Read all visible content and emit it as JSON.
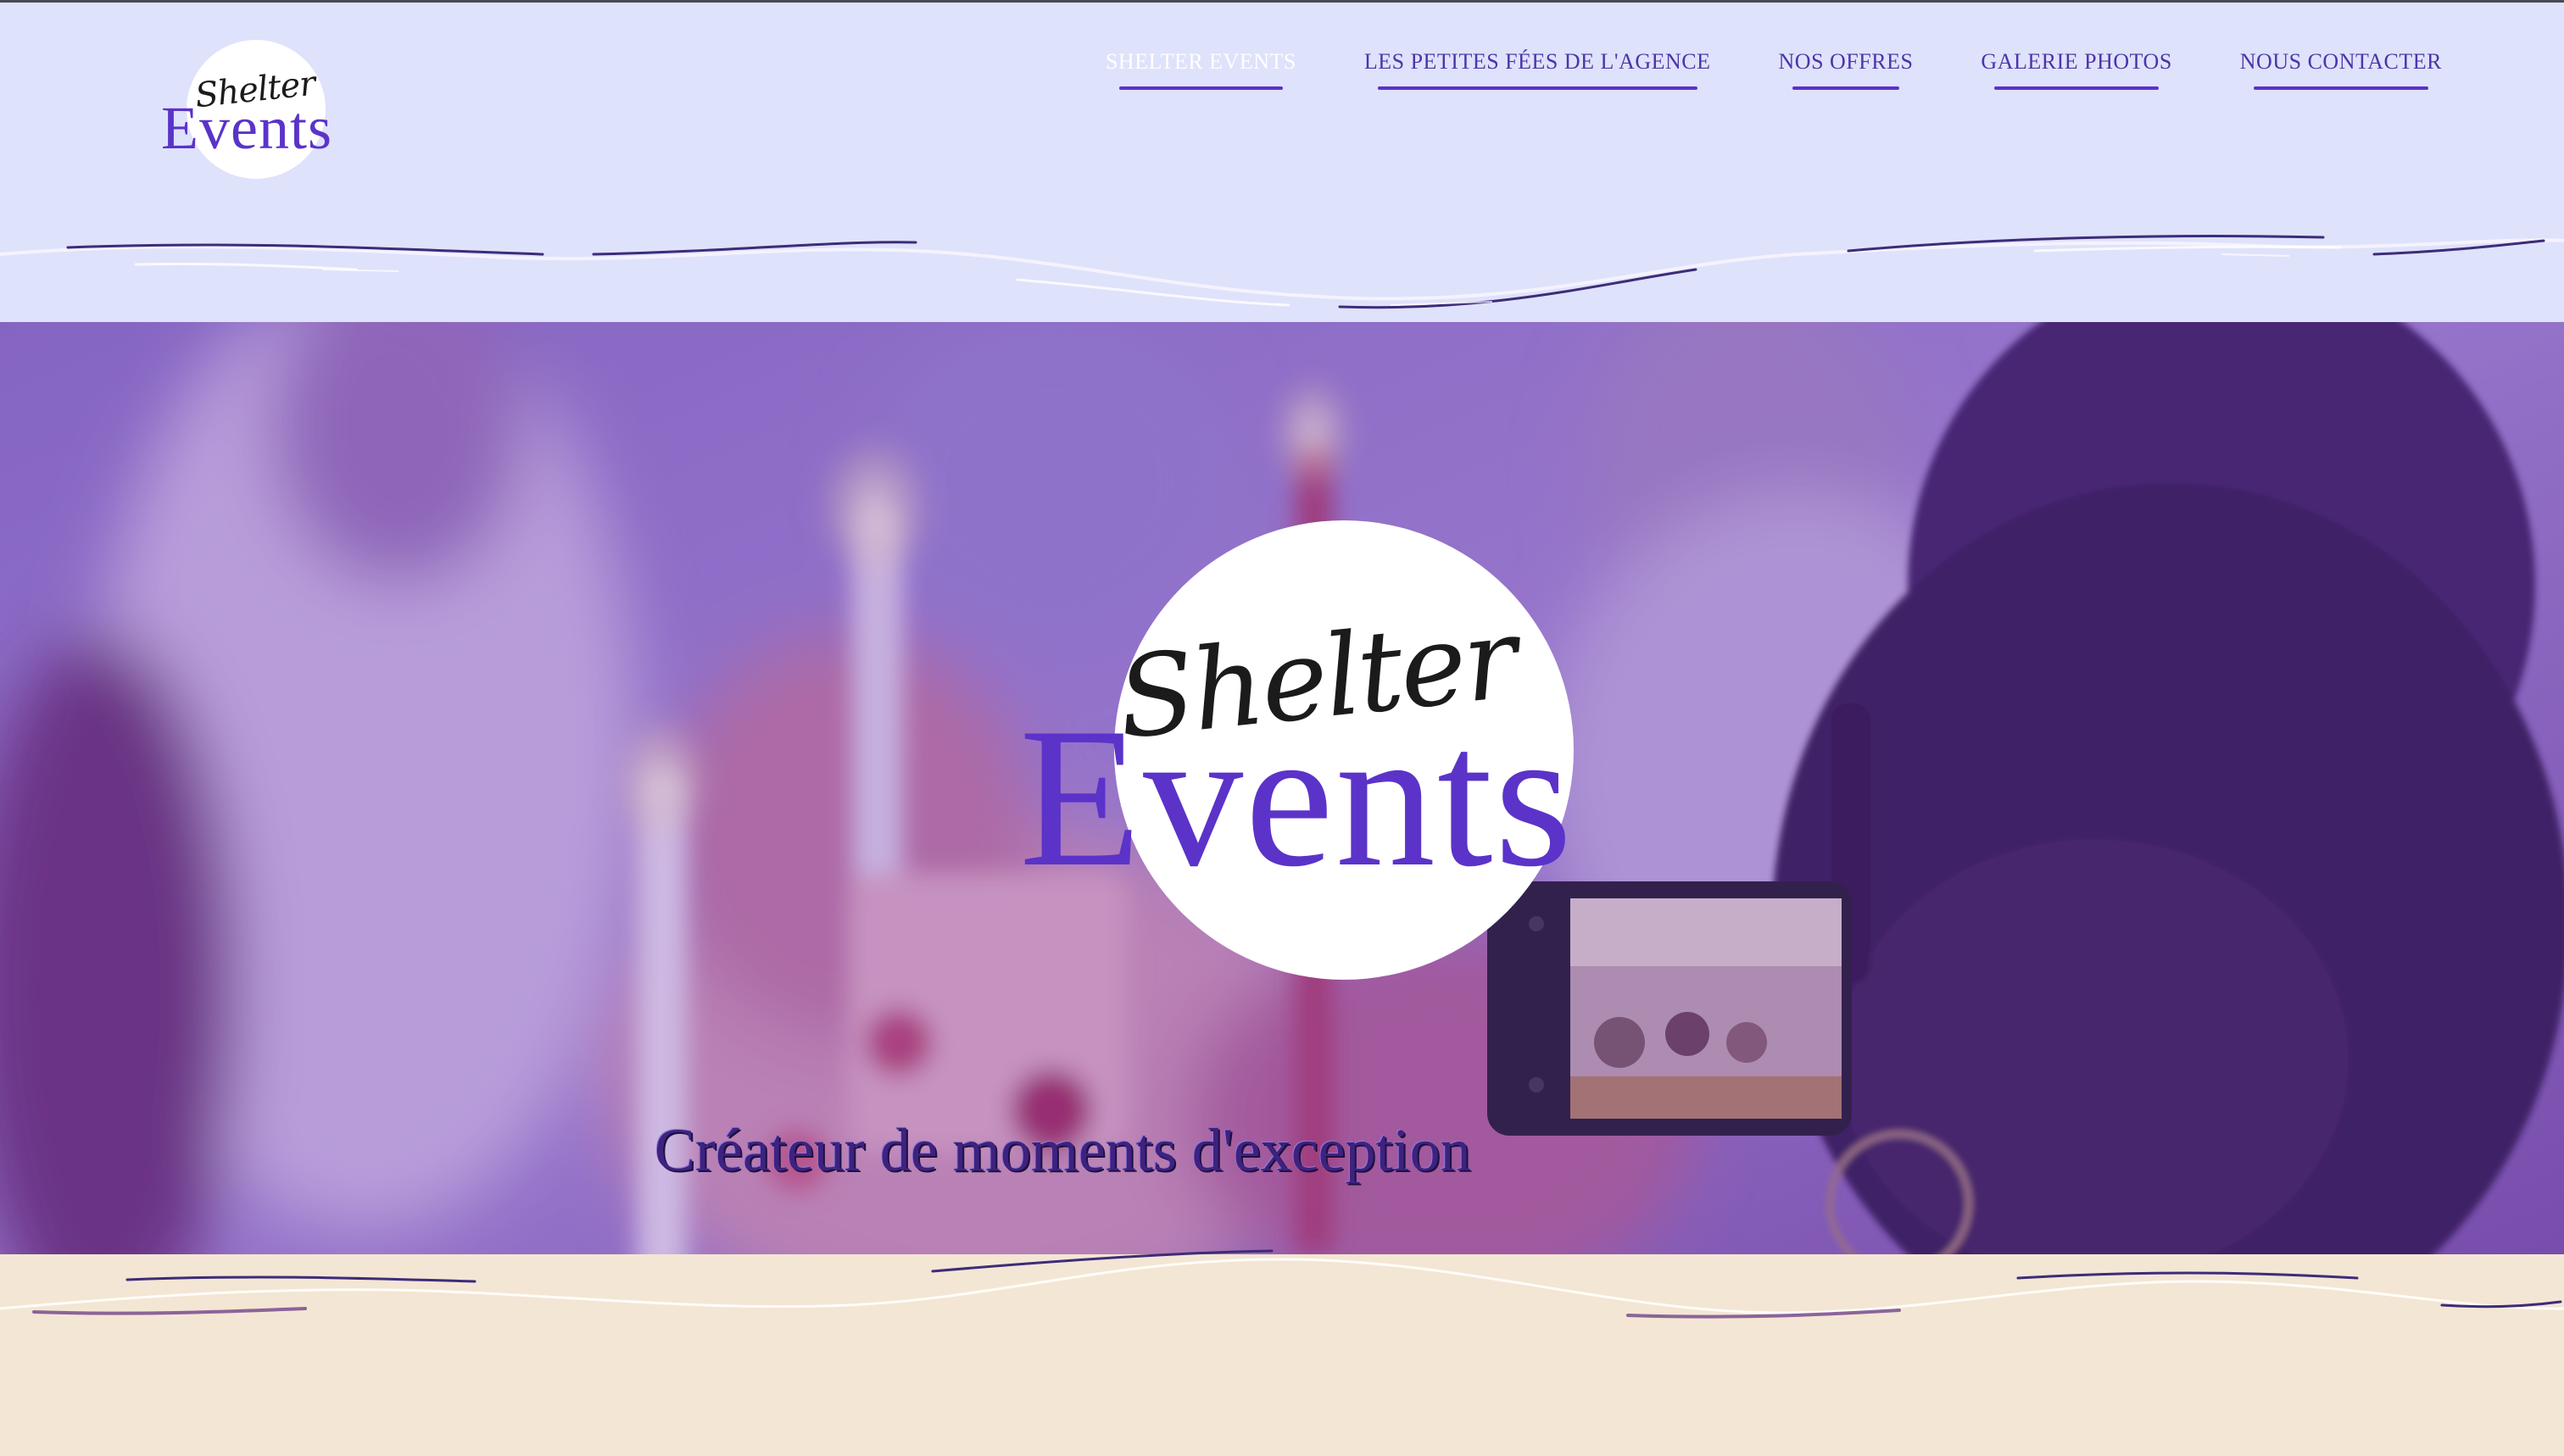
{
  "brand": {
    "logo_script": "Shelter",
    "logo_main": "Events"
  },
  "nav": {
    "items": [
      {
        "label": "SHELTER EVENTS",
        "active": true
      },
      {
        "label": "LES PETITES FÉES DE L'AGENCE",
        "active": false
      },
      {
        "label": "NOS OFFRES",
        "active": false
      },
      {
        "label": "GALERIE PHOTOS",
        "active": false
      },
      {
        "label": "NOUS CONTACTER",
        "active": false
      }
    ]
  },
  "hero": {
    "tagline": "Créateur de moments d'exception"
  },
  "colors": {
    "header_background": "#dfe2fb",
    "brand_purple": "#5b33c9",
    "footer_background": "#f4e6d4",
    "hero_overlay": "#6a3fb0"
  }
}
